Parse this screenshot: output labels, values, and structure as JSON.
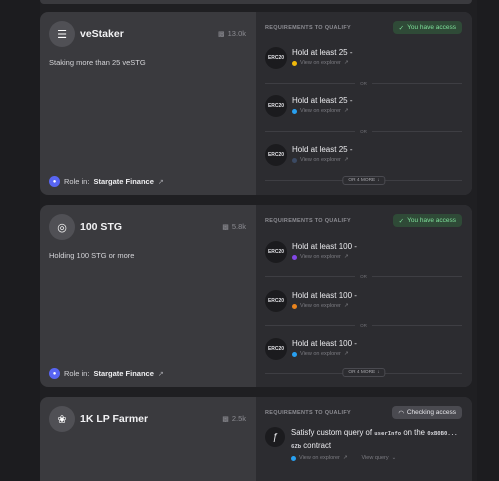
{
  "cards": [
    {
      "role_name": "veStaker",
      "role_icon": "stack-icon",
      "members": "13.0k",
      "description": "Staking more than 25 veSTG",
      "role_in_label": "Role in:",
      "role_in_server": "Stargate Finance",
      "requirements_header": "REQUIREMENTS TO QUALIFY",
      "status": "You have access",
      "requirements": [
        {
          "token": "ERC20",
          "title": "Hold at least 25 -",
          "link": "View on explorer",
          "chain_color": "#f0b90b"
        },
        {
          "token": "ERC20",
          "title": "Hold at least 25 -",
          "link": "View on explorer",
          "chain_color": "#28a0f0"
        },
        {
          "token": "ERC20",
          "title": "Hold at least 25 -",
          "link": "View on explorer",
          "chain_color": "#213147"
        }
      ],
      "or_label": "OR",
      "more_label": "OR 4 MORE"
    },
    {
      "role_name": "100 STG",
      "role_icon": "coin-icon",
      "members": "5.8k",
      "description": "Holding 100 STG or more",
      "role_in_label": "Role in:",
      "role_in_server": "Stargate Finance",
      "requirements_header": "REQUIREMENTS TO QUALIFY",
      "status": "You have access",
      "requirements": [
        {
          "token": "ERC20",
          "title": "Hold at least 100 -",
          "link": "View on explorer",
          "chain_color": "#8247e5"
        },
        {
          "token": "ERC20",
          "title": "Hold at least 100 -",
          "link": "View on explorer",
          "chain_color": "#e8831d"
        },
        {
          "token": "ERC20",
          "title": "Hold at least 100 -",
          "link": "View on explorer",
          "chain_color": "#28a0f0"
        }
      ],
      "or_label": "OR",
      "more_label": "OR 4 MORE"
    },
    {
      "role_name": "1K LP Farmer",
      "role_icon": "sprout-icon",
      "members": "2.5k",
      "requirements_header": "REQUIREMENTS TO QUALIFY",
      "status": "Checking access",
      "custom": {
        "prefix": "Satisfy custom query of",
        "query": "userInfo",
        "middle": "on the",
        "address": "0xB0B0...",
        "address2": "6Zb",
        "suffix": "contract",
        "link": "View on explorer",
        "view_query": "View query"
      }
    }
  ],
  "colors": {
    "access_bg": "#2f4a37",
    "access_text": "#7ee09a",
    "card_left": "#3a3a3e",
    "card_right": "#2c2c30",
    "discord": "#5865f2"
  }
}
